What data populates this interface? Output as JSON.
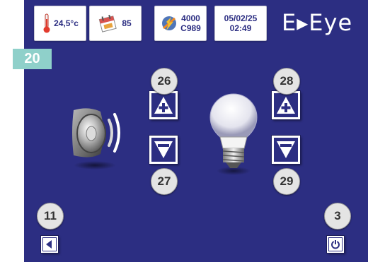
{
  "status_bar": {
    "temperature": "24,5°c",
    "calendar_value": "85",
    "counter_top": "4000",
    "counter_bottom": "C989",
    "date": "05/02/25",
    "time": "02:49"
  },
  "brand": {
    "name": "E▸Eye"
  },
  "screen_number": "20",
  "controls": {
    "sound_up_badge": "26",
    "sound_down_badge": "27",
    "light_up_badge": "28",
    "light_down_badge": "29",
    "back_badge": "11",
    "power_badge": "3"
  },
  "colors": {
    "background": "#2c2e82",
    "screen_tag": "#8fd0ca",
    "button_border": "#ffffff",
    "badge": "#e4e4e4"
  },
  "icons": [
    "thermometer-icon",
    "calendar-icon",
    "meter-icon",
    "speaker-icon",
    "light-bulb-icon",
    "plus-icon",
    "minus-icon",
    "back-arrow-icon",
    "power-icon"
  ]
}
